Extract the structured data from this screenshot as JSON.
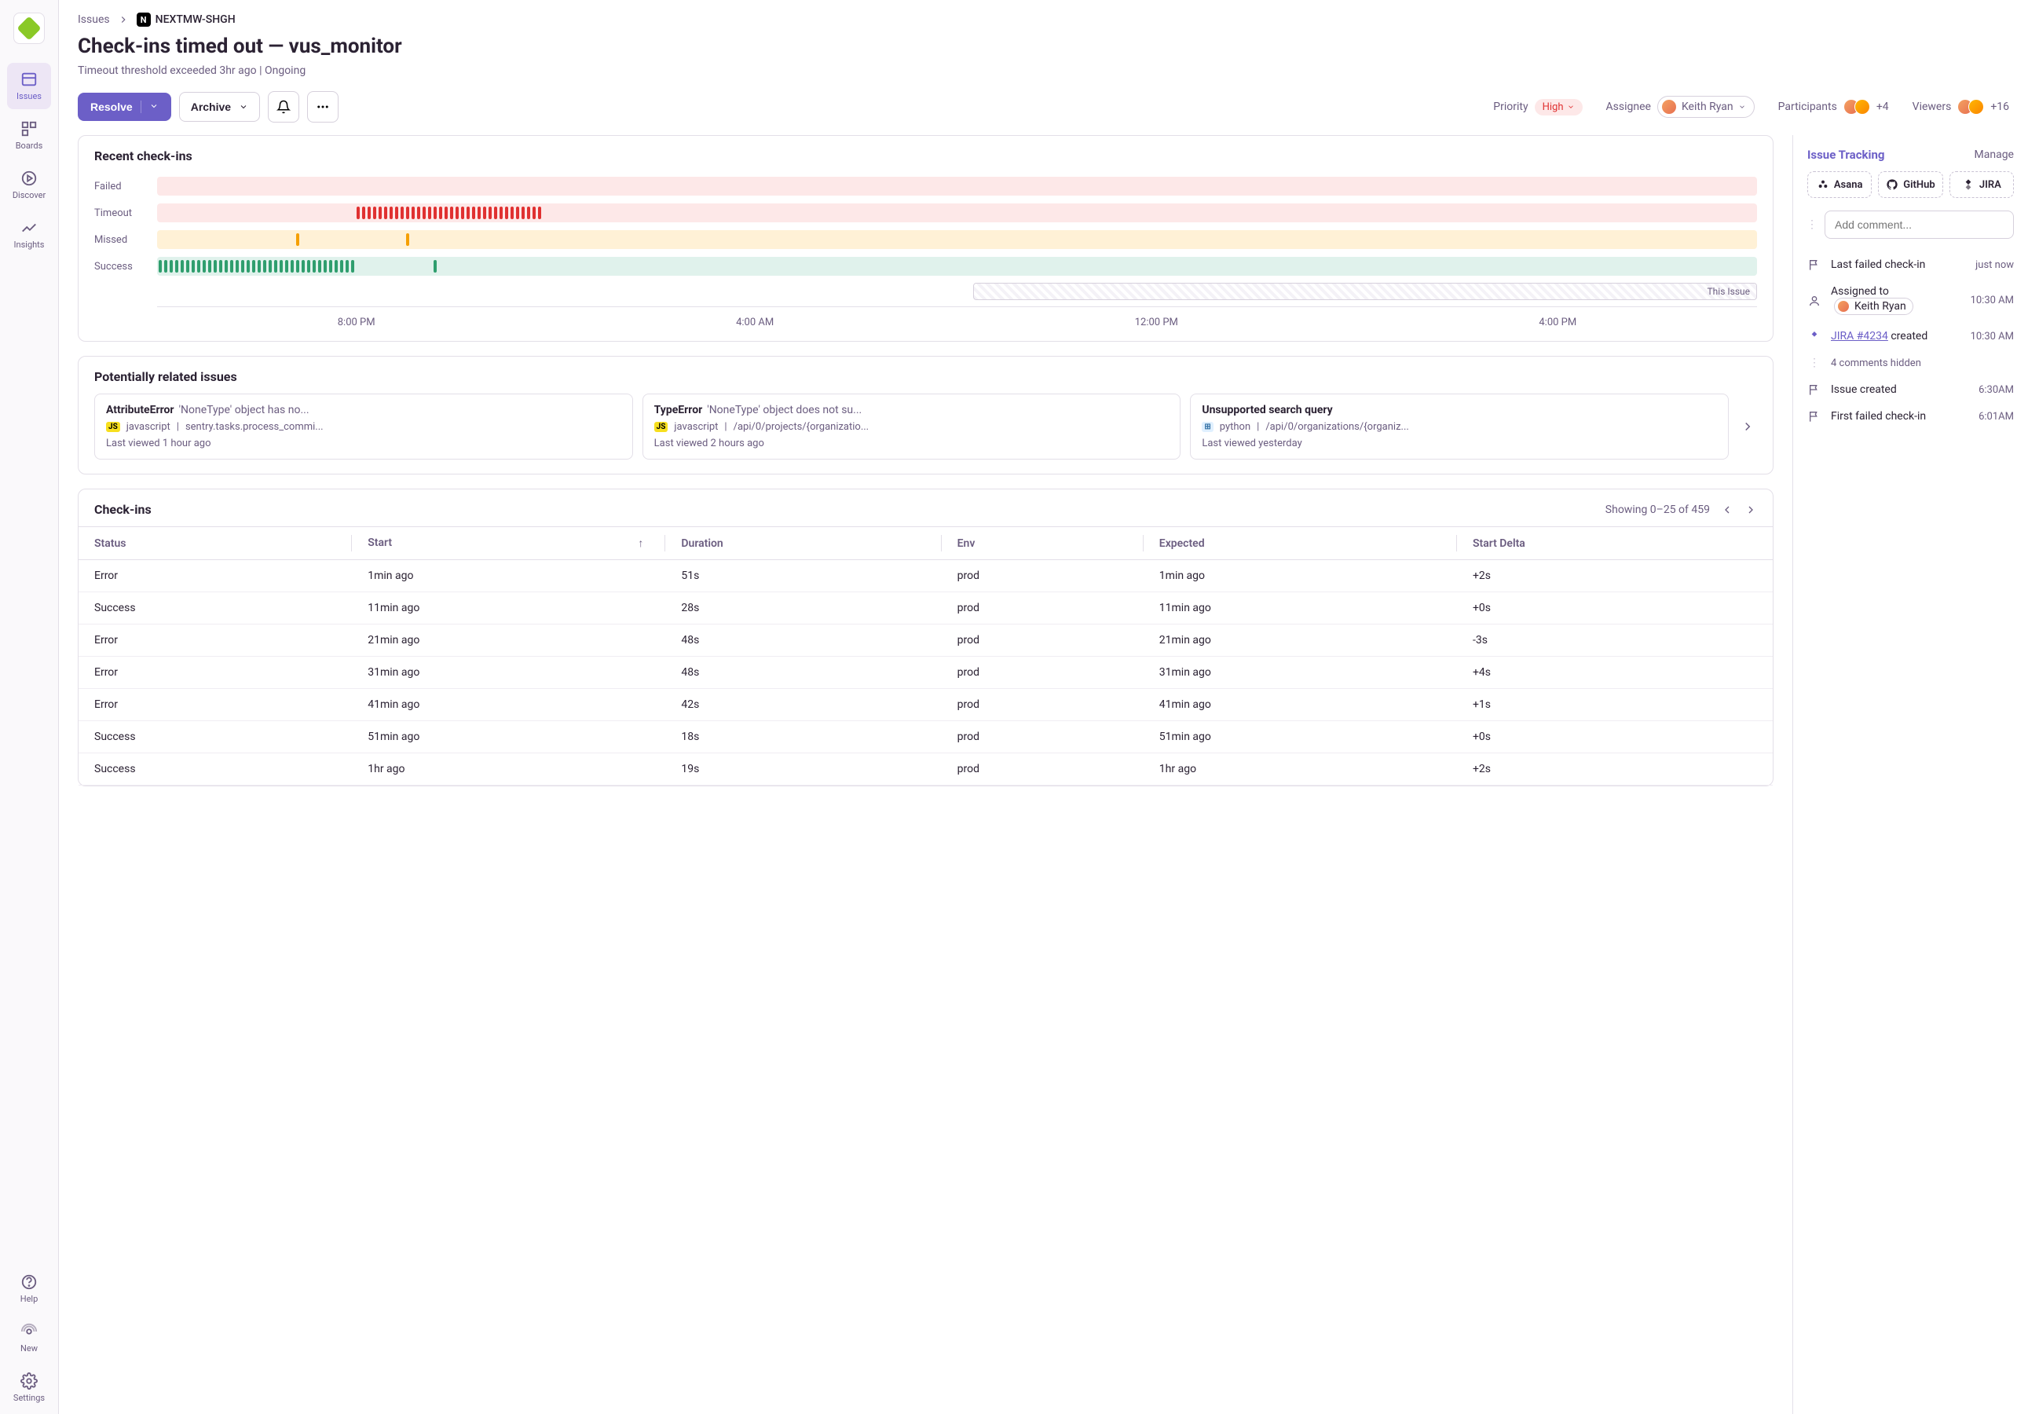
{
  "nav": {
    "items": [
      {
        "label": "Issues",
        "active": true
      },
      {
        "label": "Boards",
        "active": false
      },
      {
        "label": "Discover",
        "active": false
      },
      {
        "label": "Insights",
        "active": false
      }
    ],
    "bottom": [
      {
        "label": "Help"
      },
      {
        "label": "New"
      },
      {
        "label": "Settings"
      }
    ]
  },
  "breadcrumb": {
    "root": "Issues",
    "project": "NEXTMW-SHGH"
  },
  "title": "Check-ins timed out — vus_monitor",
  "subtitle_a": "Timeout threshold exceeded 3hr ago",
  "subtitle_b": "Ongoing",
  "actions": {
    "resolve": "Resolve",
    "archive": "Archive"
  },
  "meta": {
    "priority_label": "Priority",
    "priority_value": "High",
    "assignee_label": "Assignee",
    "assignee_name": "Keith Ryan",
    "participants_label": "Participants",
    "participants_count": "+4",
    "viewers_label": "Viewers",
    "viewers_count": "+16"
  },
  "checkins_card": {
    "title": "Recent check-ins",
    "rows": [
      "Failed",
      "Timeout",
      "Missed",
      "Success"
    ],
    "this_issue": "This Issue",
    "axis": [
      "8:00 PM",
      "4:00 AM",
      "12:00 PM",
      "4:00 PM"
    ]
  },
  "related_card": {
    "title": "Potentially related issues",
    "items": [
      {
        "err": "AttributeError",
        "desc": "'NoneType' object has no...",
        "lang": "javascript",
        "langBadge": "JS",
        "path": "sentry.tasks.process_commi...",
        "last": "Last viewed 1 hour ago"
      },
      {
        "err": "TypeError",
        "desc": "'NoneType' object does not su...",
        "lang": "javascript",
        "langBadge": "JS",
        "path": "/api/0/projects/{organizatio...",
        "last": "Last viewed 2 hours ago"
      },
      {
        "err": "Unsupported search query",
        "desc": "",
        "lang": "python",
        "langBadge": "",
        "path": "/api/0/organizations/{organiz...",
        "last": "Last viewed yesterday"
      }
    ]
  },
  "table": {
    "title": "Check-ins",
    "showing": "Showing 0–25 of 459",
    "columns": [
      "Status",
      "Start",
      "Duration",
      "Env",
      "Expected",
      "Start Delta"
    ],
    "rows": [
      {
        "status": "Error",
        "start": "1min ago",
        "duration": "51s",
        "env": "prod",
        "expected": "1min ago",
        "delta": "+2s"
      },
      {
        "status": "Success",
        "start": "11min ago",
        "duration": "28s",
        "env": "prod",
        "expected": "11min ago",
        "delta": "+0s"
      },
      {
        "status": "Error",
        "start": "21min ago",
        "duration": "48s",
        "env": "prod",
        "expected": "21min ago",
        "delta": "-3s"
      },
      {
        "status": "Error",
        "start": "31min ago",
        "duration": "48s",
        "env": "prod",
        "expected": "31min ago",
        "delta": "+4s"
      },
      {
        "status": "Error",
        "start": "41min ago",
        "duration": "42s",
        "env": "prod",
        "expected": "41min ago",
        "delta": "+1s"
      },
      {
        "status": "Success",
        "start": "51min ago",
        "duration": "18s",
        "env": "prod",
        "expected": "51min ago",
        "delta": "+0s"
      },
      {
        "status": "Success",
        "start": "1hr ago",
        "duration": "19s",
        "env": "prod",
        "expected": "1hr ago",
        "delta": "+2s"
      }
    ]
  },
  "tracking": {
    "title": "Issue Tracking",
    "manage": "Manage",
    "integrations": [
      "Asana",
      "GitHub",
      "JIRA"
    ],
    "comment_placeholder": "Add comment...",
    "timeline": [
      {
        "icon": "flag",
        "text": "Last failed check-in",
        "time": "just now"
      },
      {
        "icon": "user",
        "html": "Assigned to",
        "assignee": "Keith Ryan",
        "time": "10:30 AM"
      },
      {
        "icon": "jira",
        "link": "JIRA #4234",
        "suffix": " created",
        "time": "10:30 AM"
      },
      {
        "icon": "dots",
        "text": "4 comments hidden",
        "hidden": true
      },
      {
        "icon": "flag",
        "text": "Issue created",
        "time": "6:30AM"
      },
      {
        "icon": "flag",
        "text": "First failed check-in",
        "time": "6:01AM"
      }
    ]
  },
  "chart_data": {
    "type": "status-timeline",
    "rows": [
      {
        "label": "Failed",
        "pattern": []
      },
      {
        "label": "Timeout",
        "pattern": "second-half-red"
      },
      {
        "label": "Missed",
        "pattern": "two-yellow"
      },
      {
        "label": "Success",
        "pattern": "first-half-green"
      }
    ],
    "axis": [
      "8:00 PM",
      "4:00 AM",
      "12:00 PM",
      "4:00 PM"
    ],
    "current_issue_start_pct": 51
  }
}
